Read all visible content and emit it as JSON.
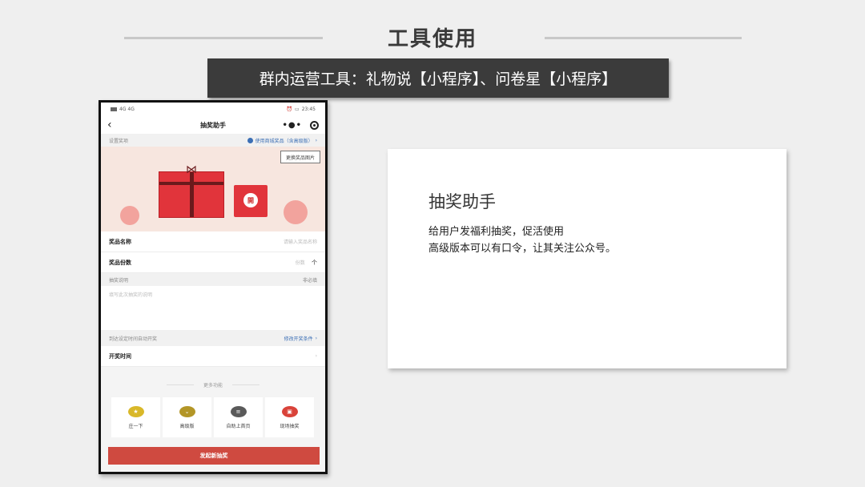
{
  "slide": {
    "title": "工具使用",
    "subtitle": "群内运营工具：礼物说【小程序】、问卷星【小程序】"
  },
  "phone": {
    "status_left": "4G 4G",
    "status_time": "23:45",
    "nav_title": "抽奖助手",
    "settings_label": "设置奖项",
    "shop_link": "使用商城奖品（含高级版）",
    "change_image_label": "更换奖品图片",
    "envelope_char": "開",
    "prize_name_label": "奖品名称",
    "prize_name_placeholder": "请输入奖品名称",
    "prize_count_label": "奖品份数",
    "prize_count_placeholder": "份数",
    "prize_count_unit": "个",
    "desc_label": "抽奖说明",
    "desc_optional": "非必填",
    "desc_placeholder": "填写此次抽奖的说明",
    "auto_draw_label": "到达设定时间自动开奖",
    "modify_condition_link": "修改开奖条件",
    "draw_time_label": "开奖时间",
    "more_features_label": "更多功能",
    "features": [
      {
        "label": "庄一下",
        "icon": "star-icon",
        "color": "#d9b829"
      },
      {
        "label": "高级版",
        "icon": "chevron-icon",
        "color": "#b39627"
      },
      {
        "label": "自助上首页",
        "icon": "list-icon",
        "color": "#5a5a5a"
      },
      {
        "label": "现场抽奖",
        "icon": "ticket-icon",
        "color": "#d9433a"
      }
    ],
    "submit_label": "发起新抽奖"
  },
  "info": {
    "title": "抽奖助手",
    "line1": "给用户发福利抽奖，促活使用",
    "line2": "高级版本可以有口令，让其关注公众号。"
  }
}
